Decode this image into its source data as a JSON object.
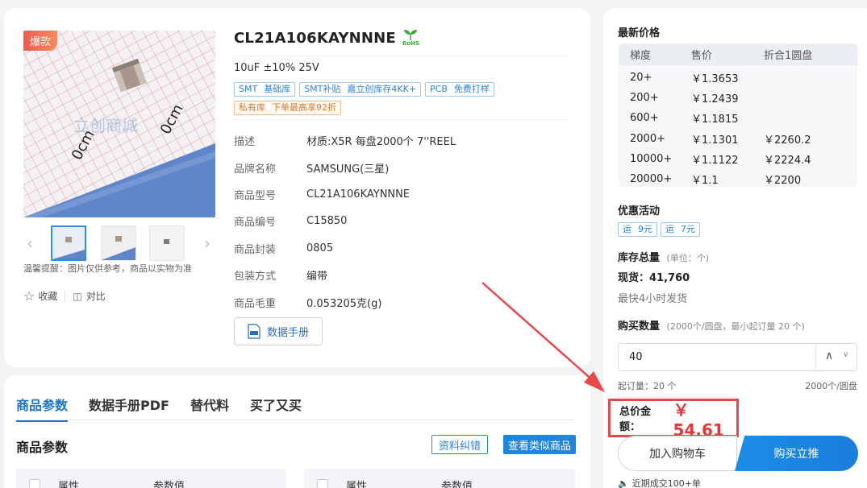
{
  "gallery": {
    "hot_badge": "爆款",
    "tip": "温馨提醒：图片仅供参考，商品以实物为准",
    "collect_label": "收藏",
    "compare_label": "对比",
    "watermark": "立创商城",
    "ruler_label_1": "0cm",
    "ruler_label_2": "0cm"
  },
  "product": {
    "title": "CL21A106KAYNNNE",
    "rohs": "RoHS",
    "spec": "10uF ±10% 25V",
    "tags": [
      {
        "parts": [
          "SMT",
          "基础库"
        ]
      },
      {
        "parts": [
          "SMT补贴",
          "嘉立创库存4KK+"
        ]
      },
      {
        "parts": [
          "PCB",
          "免费打样"
        ]
      }
    ],
    "private_tag": {
      "parts": [
        "私有库",
        "下单最高享92折"
      ]
    },
    "attributes": [
      {
        "key": "描述",
        "value": "材质:X5R 每盘2000个 7''REEL"
      },
      {
        "key": "品牌名称",
        "value": "SAMSUNG(三星)"
      },
      {
        "key": "商品型号",
        "value": "CL21A106KAYNNNE"
      },
      {
        "key": "商品编号",
        "value": "C15850"
      },
      {
        "key": "商品封装",
        "value": "0805"
      },
      {
        "key": "包装方式",
        "value": "编带"
      },
      {
        "key": "商品毛重",
        "value": "0.053205克(g)"
      }
    ],
    "datasheet_button": "数据手册"
  },
  "tabs": {
    "items": [
      "商品参数",
      "数据手册PDF",
      "替代料",
      "买了又买"
    ],
    "section_title": "商品参数",
    "error_button": "资料纠错",
    "similar_button": "查看类似商品",
    "col_attr": "属性",
    "col_value": "参数值"
  },
  "pricing": {
    "title": "最新价格",
    "headers": [
      "梯度",
      "售价",
      "折合1圆盘"
    ],
    "rows": [
      {
        "qty": "20+",
        "price": "￥1.3653",
        "reel": ""
      },
      {
        "qty": "200+",
        "price": "￥1.2439",
        "reel": ""
      },
      {
        "qty": "600+",
        "price": "￥1.1815",
        "reel": ""
      },
      {
        "qty": "2000+",
        "price": "￥1.1301",
        "reel": "￥2260.2"
      },
      {
        "qty": "10000+",
        "price": "￥1.1122",
        "reel": "￥2224.4"
      },
      {
        "qty": "20000+",
        "price": "￥1.1",
        "reel": "￥2200"
      }
    ]
  },
  "promo": {
    "title": "优惠活动",
    "tags": [
      {
        "parts": [
          "运",
          "9元"
        ]
      },
      {
        "parts": [
          "运",
          "7元"
        ]
      }
    ]
  },
  "stock": {
    "title": "库存总量",
    "unit_note": "(单位：个)",
    "stock_label": "现货：",
    "stock_value": "41,760",
    "ship_note": "最快4小时发货"
  },
  "quantity": {
    "title": "购买数量",
    "note": "(2000个/圆盘，最小起订量 20 个)",
    "value": "40",
    "moq": "起订量：20 个",
    "per_reel": "2000个/圆盘"
  },
  "total": {
    "label": "总价金额：",
    "value": "￥ 54.61"
  },
  "actions": {
    "cart": "加入购物车",
    "buy": "购买立推"
  },
  "recent": "近期成交100+单",
  "colors": {
    "accent": "#1f86e0",
    "price_red": "#e5383b",
    "annotation_red": "#e8484a"
  }
}
